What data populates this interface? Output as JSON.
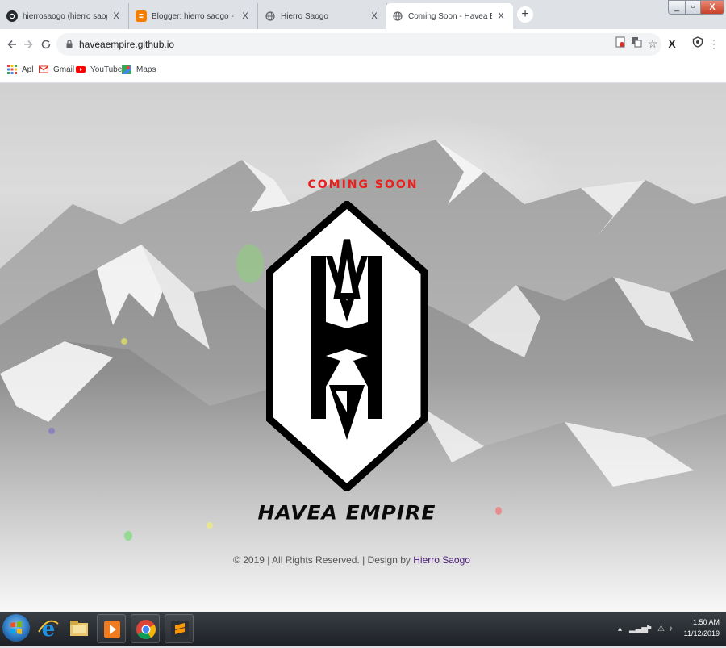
{
  "browser": {
    "tabs": [
      {
        "title": "hierrosaogo (hierro saogo)",
        "icon": "github-icon",
        "active": false
      },
      {
        "title": "Blogger: hierro saogo - Semua p",
        "icon": "blogger-icon",
        "active": false
      },
      {
        "title": "Hierro Saogo",
        "icon": "globe-icon",
        "active": false
      },
      {
        "title": "Coming Soon - Havea Empire Of",
        "icon": "globe-icon",
        "active": true
      }
    ],
    "tab_close_glyph": "X",
    "new_tab_glyph": "+",
    "window_controls": {
      "minimize": "_",
      "maximize": "▫",
      "close": "X"
    },
    "url": "haveaempire.github.io",
    "extension_icons": [
      "pdf-extension-icon",
      "translate-icon",
      "bookmark-star-icon",
      "x-extension-icon",
      "shield-extension-icon",
      "menu-dots-icon"
    ],
    "bookmarks": [
      {
        "label": "Apl",
        "icon": "apps-grid-icon"
      },
      {
        "label": "Gmail",
        "icon": "gmail-icon"
      },
      {
        "label": "YouTube",
        "icon": "youtube-icon"
      },
      {
        "label": "Maps",
        "icon": "maps-icon"
      }
    ]
  },
  "page": {
    "coming_soon": "COMING SOON",
    "brand": "HAVEA EMPIRE",
    "footer_text": "© 2019 | All Rights Reserved. | Design by ",
    "footer_link": "Hierro Saogo",
    "accent_color": "#e8201e"
  },
  "taskbar": {
    "apps": [
      "internet-explorer-icon",
      "file-explorer-icon",
      "media-player-icon",
      "chrome-icon",
      "sublime-text-icon"
    ],
    "time": "1:50 AM",
    "date": "11/12/2019"
  }
}
